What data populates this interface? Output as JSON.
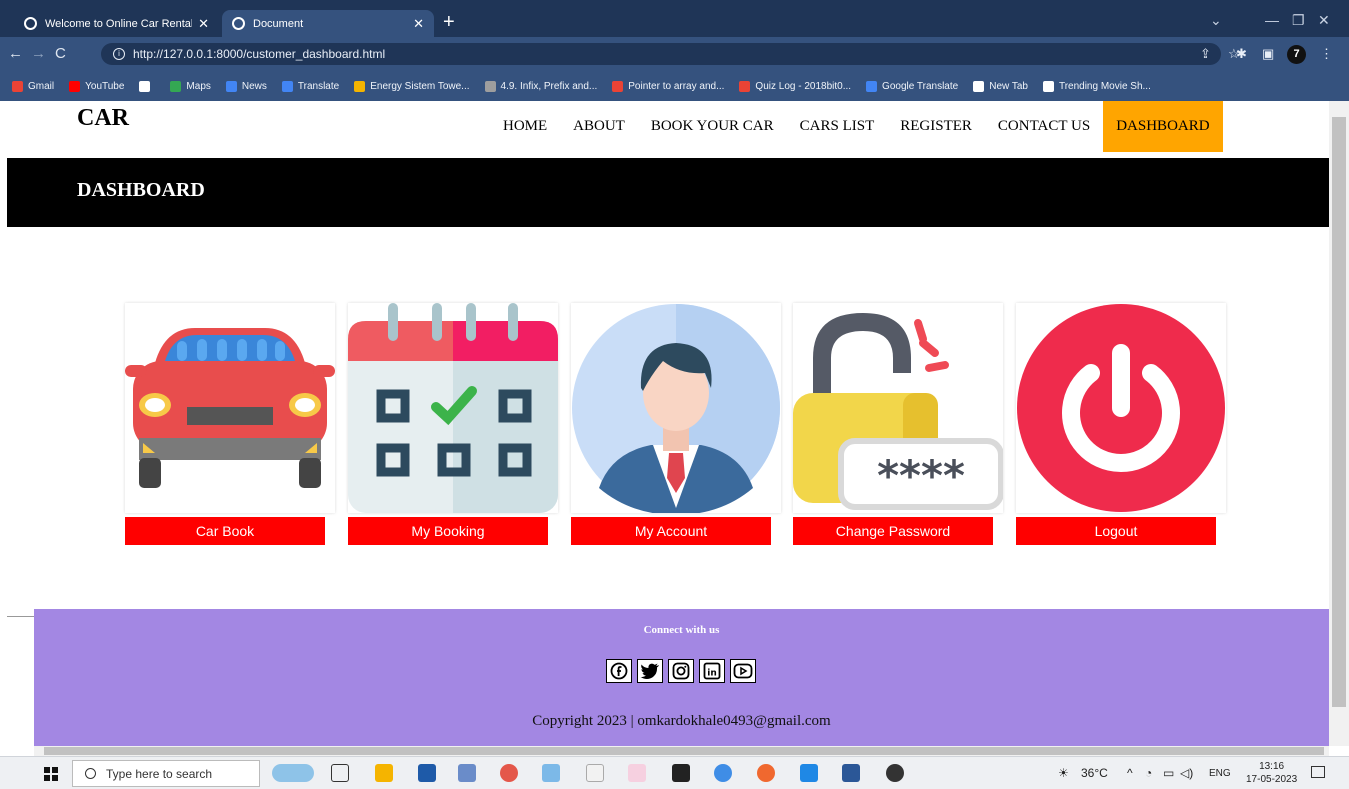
{
  "browser": {
    "tabs": [
      {
        "label": "Welcome to Online Car Rental sy"
      },
      {
        "label": "Document"
      }
    ],
    "url": "http://127.0.0.1:8000/customer_dashboard.html",
    "profile_badge": "7",
    "bookmarks": [
      {
        "label": "Gmail",
        "color": "#ea4335"
      },
      {
        "label": "YouTube",
        "color": "#ff0000"
      },
      {
        "label": "",
        "color": "#ffffff"
      },
      {
        "label": "Maps",
        "color": "#34a853"
      },
      {
        "label": "News",
        "color": "#4285f4"
      },
      {
        "label": "Translate",
        "color": "#4285f4"
      },
      {
        "label": "Energy Sistem Towe...",
        "color": "#f4b400"
      },
      {
        "label": "4.9. Infix, Prefix and...",
        "color": "#9e9e9e"
      },
      {
        "label": "Pointer to array and...",
        "color": "#ea4335"
      },
      {
        "label": "Quiz Log - 2018bit0...",
        "color": "#ea4335"
      },
      {
        "label": "Google Translate",
        "color": "#4285f4"
      },
      {
        "label": "New Tab",
        "color": "#ffffff"
      },
      {
        "label": "Trending Movie Sh...",
        "color": "#ffffff"
      }
    ]
  },
  "site": {
    "logo": "CAR",
    "nav": [
      "HOME",
      "ABOUT",
      "BOOK YOUR CAR",
      "CARS LIST",
      "REGISTER",
      "CONTACT US",
      "DASHBOARD"
    ],
    "active_nav": "DASHBOARD",
    "accent_color": "#ffa500"
  },
  "banner": {
    "title": "DASHBOARD"
  },
  "cards": [
    {
      "icon": "car-icon",
      "label": "Car Book"
    },
    {
      "icon": "calendar-icon",
      "label": "My Booking"
    },
    {
      "icon": "user-avatar-icon",
      "label": "My Account"
    },
    {
      "icon": "padlock-icon",
      "label": "Change Password"
    },
    {
      "icon": "power-icon",
      "label": "Logout"
    }
  ],
  "footer": {
    "connect": "Connect with us",
    "social": [
      "facebook-icon",
      "twitter-icon",
      "instagram-icon",
      "linkedin-icon",
      "youtube-icon"
    ],
    "copyright": "Copyright 2023 | omkardokhale0493@gmail.com",
    "background": "#a387e3"
  },
  "taskbar": {
    "search_placeholder": "Type here to search",
    "weather": "36°C",
    "language": "ENG",
    "time": "13:16",
    "date": "17-05-2023"
  }
}
